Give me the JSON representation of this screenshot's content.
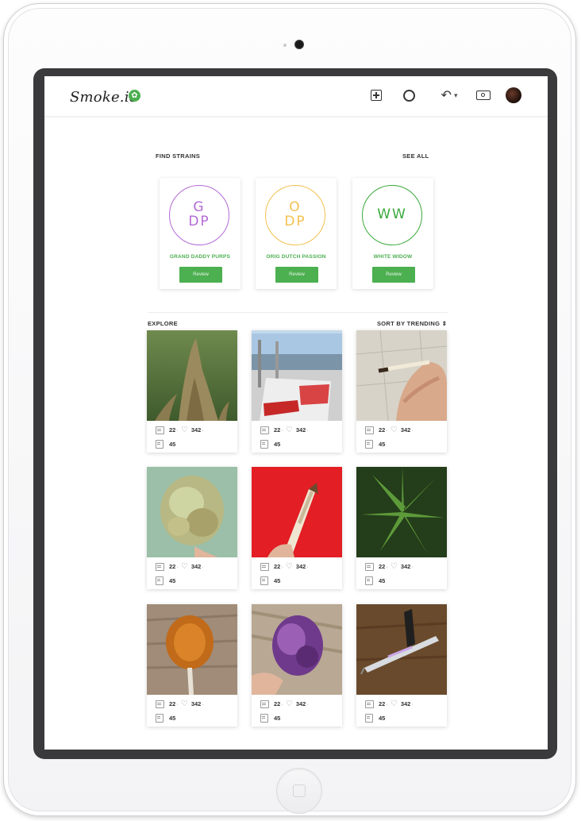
{
  "app": {
    "logo_text": "Smoke.io",
    "logo_icon": "leaf-icon",
    "brand_color": "#4caf50"
  },
  "nav": {
    "icons": [
      "add-post-icon",
      "compass-icon",
      "reply-all-icon",
      "wallet-icon",
      "avatar"
    ],
    "reply_caret": "▾"
  },
  "find_strains": {
    "title": "FIND STRAINS",
    "see_all": "SEE ALL",
    "strains": [
      {
        "initials_1": "G",
        "initials_2": "DP",
        "name": "GRAND DADDY PURPS",
        "circle_color": "#b36ad6",
        "review_label": "Review"
      },
      {
        "initials_1": "O",
        "initials_2": "DP",
        "name": "ORIG DUTCH PASSION",
        "circle_color": "#f2c04f",
        "review_label": "Review"
      },
      {
        "initials_1": "WW",
        "initials_2": "",
        "name": "WHITE WIDOW",
        "circle_color": "#3aa83a",
        "review_label": "Review"
      }
    ]
  },
  "explore": {
    "title": "EXPLORE",
    "sort_label": "SORT BY TRENDING ⇕",
    "posts": [
      {
        "image": "cannabis-bud-field",
        "comments": "22",
        "likes": "342",
        "sep": "·",
        "extra": "45"
      },
      {
        "image": "the-best-bag-photo",
        "comments": "22",
        "likes": "342",
        "sep": "·",
        "extra": "45"
      },
      {
        "image": "hand-holding-joint",
        "comments": "22",
        "likes": "342",
        "sep": "·",
        "extra": "45"
      },
      {
        "image": "frosty-bud-closeup",
        "comments": "22",
        "likes": "342",
        "sep": "·",
        "extra": "45"
      },
      {
        "image": "joint-on-red",
        "comments": "22",
        "likes": "342",
        "sep": "·",
        "extra": "45"
      },
      {
        "image": "cannabis-leaves",
        "comments": "22",
        "likes": "342",
        "sep": "·",
        "extra": "45"
      },
      {
        "image": "amber-lollipop",
        "comments": "22",
        "likes": "342",
        "sep": "·",
        "extra": "45"
      },
      {
        "image": "purple-bud-in-hand",
        "comments": "22",
        "likes": "342",
        "sep": "·",
        "extra": "45"
      },
      {
        "image": "vape-pen-syringe",
        "comments": "22",
        "likes": "342",
        "sep": "·",
        "extra": "45"
      }
    ]
  }
}
